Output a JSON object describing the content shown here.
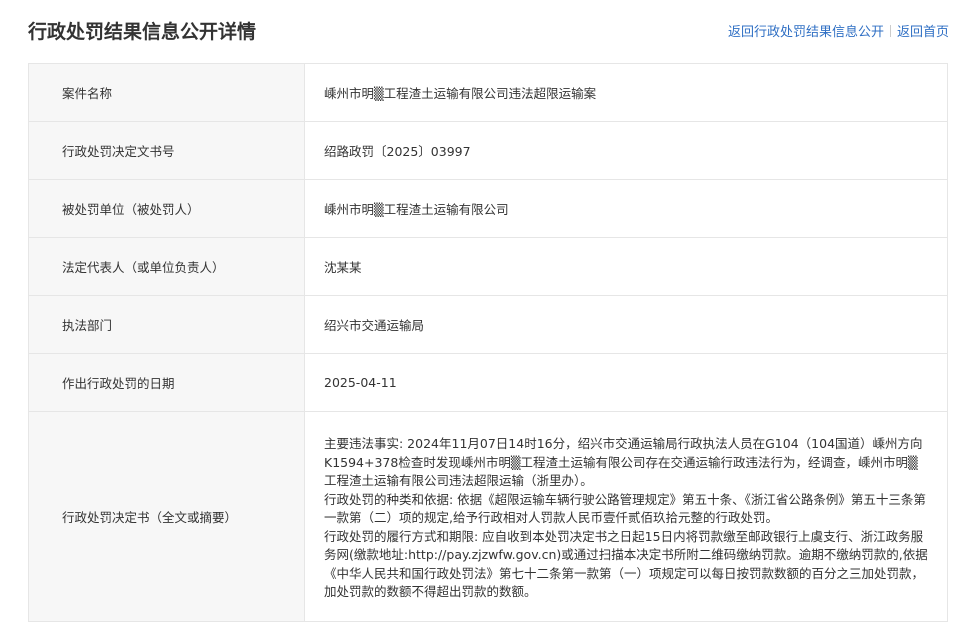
{
  "header": {
    "title": "行政处罚结果信息公开详情",
    "back_to_list_label": "返回行政处罚结果信息公开",
    "home_label": "返回首页"
  },
  "rows": [
    {
      "label": "案件名称",
      "value": "嵊州市明▒工程渣土运输有限公司违法超限运输案"
    },
    {
      "label": "行政处罚决定文书号",
      "value": "绍路政罚〔2025〕03997"
    },
    {
      "label": "被处罚单位（被处罚人）",
      "value": "嵊州市明▒工程渣土运输有限公司"
    },
    {
      "label": "法定代表人（或单位负责人）",
      "value": "沈某某"
    },
    {
      "label": "执法部门",
      "value": "绍兴市交通运输局"
    },
    {
      "label": "作出行政处罚的日期",
      "value": "2025-04-11"
    }
  ],
  "decision": {
    "label": "行政处罚决定书（全文或摘要）",
    "paragraphs": [
      "主要违法事实: 2024年11月07日14时16分，绍兴市交通运输局行政执法人员在G104（104国道）嵊州方向K1594+378检查时发现嵊州市明▒工程渣土运输有限公司存在交通运输行政违法行为，经调查，嵊州市明▒工程渣土运输有限公司违法超限运输（浙里办）。",
      "行政处罚的种类和依据: 依据《超限运输车辆行驶公路管理规定》第五十条、《浙江省公路条例》第五十三条第一款第（二）项的规定,给予行政相对人罚款人民币壹仟贰佰玖拾元整的行政处罚。",
      "行政处罚的履行方式和期限: 应自收到本处罚决定书之日起15日内将罚款缴至邮政银行上虞支行、浙江政务服务网(缴款地址:http://pay.zjzwfw.gov.cn)或通过扫描本决定书所附二维码缴纳罚款。逾期不缴纳罚款的,依据《中华人民共和国行政处罚法》第七十二条第一款第（一）项规定可以每日按罚款数额的百分之三加处罚款，加处罚款的数额不得超出罚款的数额。"
    ]
  }
}
